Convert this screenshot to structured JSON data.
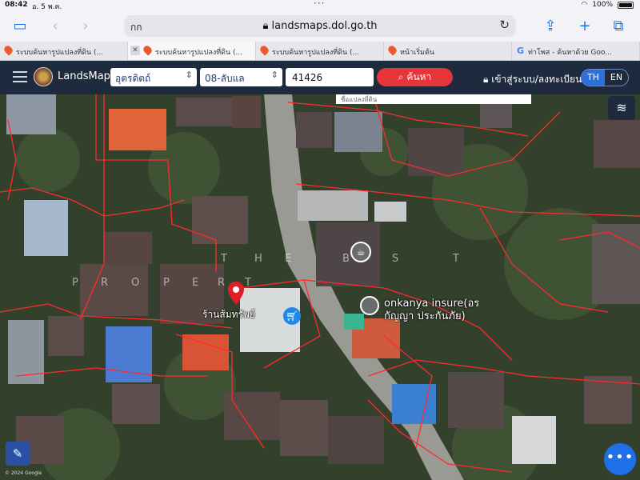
{
  "status": {
    "time": "08:42",
    "date": "อ. 5 พ.ค.",
    "wifi": "wifi-icon",
    "battery": "100%"
  },
  "browser": {
    "address_left": "กก",
    "url": "landsmaps.dol.go.th",
    "tabs": [
      {
        "label": "ระบบค้นหารูปแปลงที่ดิน (...",
        "icon": "map-pin-icon"
      },
      {
        "label": "ระบบค้นหารูปแปลงที่ดิน (...",
        "icon": "map-pin-icon",
        "active": true
      },
      {
        "label": "ระบบค้นหารูปแปลงที่ดิน (...",
        "icon": "map-pin-icon"
      },
      {
        "label": "หน้าเริ่มต้น",
        "icon": "map-pin-icon"
      },
      {
        "label": "ท่าโพส - ค้นหาด้วย Goo...",
        "icon": "google-icon"
      }
    ]
  },
  "header": {
    "brand": "LandsMaps",
    "province": "อุตรดิตถ์",
    "district": "08-ลับแล",
    "parcel_no": "41426",
    "search_label": "ค้นหา",
    "login_label": "เข้าสู่ระบบ/ลงทะเบียน",
    "lang": [
      "TH",
      "EN"
    ],
    "lang_active": "TH"
  },
  "map": {
    "top_box_text": "ชื่อแปลงที่ดิน",
    "labels": {
      "shop_name": "ร้านส้มทรัพย์",
      "insure_line1": "onkanya insure(อร",
      "insure_line2": "กัญญา ประกันภัย)"
    },
    "watermark": [
      "T",
      "H",
      "E",
      "B",
      "S",
      "T",
      "P",
      "R",
      "O",
      "P",
      "E",
      "R",
      "T"
    ],
    "fab_label": "•••",
    "bottom_tiny": "© 2024 Google",
    "colors": {
      "parcel_line": "#ff2a2a",
      "pin": "#e11d2a",
      "cart": "#1e88e5"
    }
  }
}
